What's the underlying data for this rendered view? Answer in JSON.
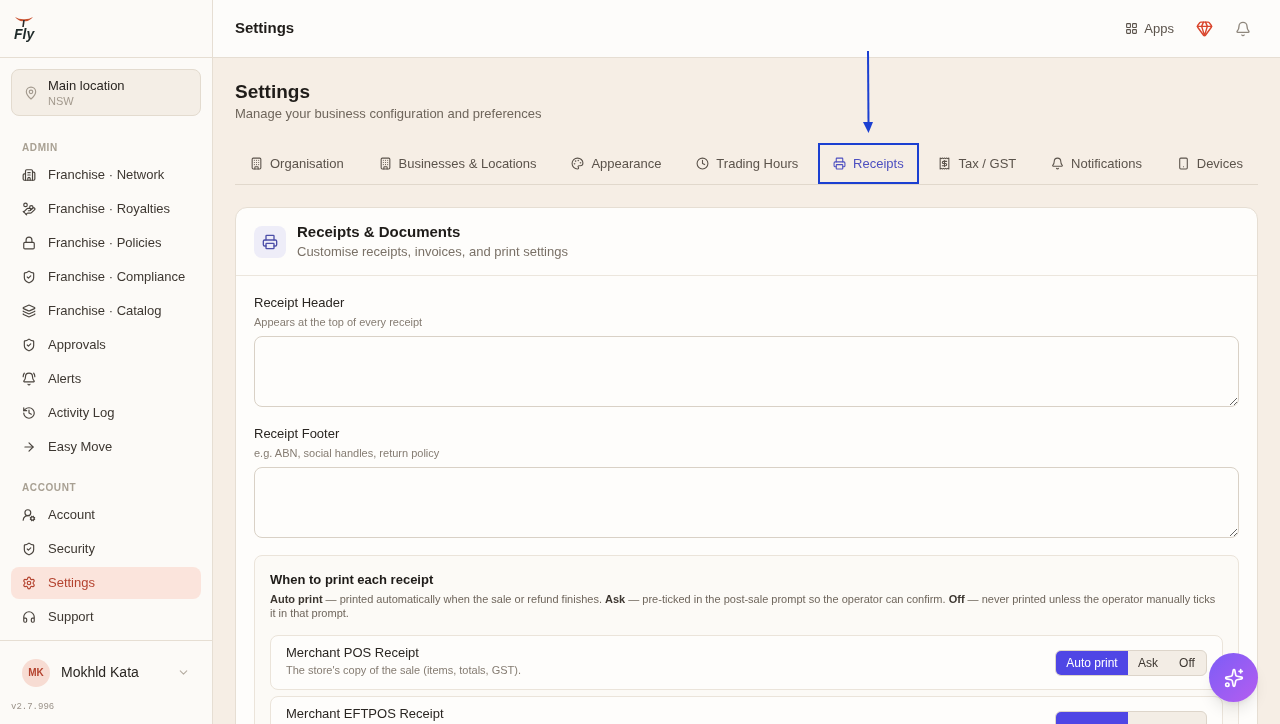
{
  "sidebar": {
    "logo": {
      "wordmark": "Fly"
    },
    "location": {
      "name": "Main location",
      "region": "NSW"
    },
    "sections": [
      {
        "title": "ADMIN",
        "items": [
          {
            "label": "Franchise · Network",
            "selected": false
          },
          {
            "label": "Franchise · Royalties",
            "selected": false
          },
          {
            "label": "Franchise · Policies",
            "selected": false
          },
          {
            "label": "Franchise · Compliance",
            "selected": false
          },
          {
            "label": "Franchise · Catalog",
            "selected": false
          },
          {
            "label": "Approvals",
            "selected": false
          },
          {
            "label": "Alerts",
            "selected": false
          },
          {
            "label": "Activity Log",
            "selected": false
          },
          {
            "label": "Easy Move",
            "selected": false
          }
        ]
      },
      {
        "title": "ACCOUNT",
        "items": [
          {
            "label": "Account",
            "selected": false
          },
          {
            "label": "Security",
            "selected": false
          },
          {
            "label": "Settings",
            "selected": true
          },
          {
            "label": "Support",
            "selected": false
          }
        ]
      }
    ],
    "user": {
      "initials": "MK",
      "name": "Mokhld Kata"
    },
    "version": "v2.7.996"
  },
  "topbar": {
    "title": "Settings",
    "apps_label": "Apps"
  },
  "page": {
    "title": "Settings",
    "subtitle": "Manage your business configuration and preferences"
  },
  "tabs": [
    {
      "label": "Organisation",
      "selected": false,
      "highlighted": false
    },
    {
      "label": "Businesses & Locations",
      "selected": false,
      "highlighted": false
    },
    {
      "label": "Appearance",
      "selected": false,
      "highlighted": false
    },
    {
      "label": "Trading Hours",
      "selected": false,
      "highlighted": false
    },
    {
      "label": "Receipts",
      "selected": true,
      "highlighted": true
    },
    {
      "label": "Tax / GST",
      "selected": false,
      "highlighted": false
    },
    {
      "label": "Notifications",
      "selected": false,
      "highlighted": false
    },
    {
      "label": "Devices",
      "selected": false,
      "highlighted": false
    }
  ],
  "card": {
    "title": "Receipts & Documents",
    "subtitle": "Customise receipts, invoices, and print settings",
    "fields": [
      {
        "label": "Receipt Header",
        "hint": "Appears at the top of every receipt"
      },
      {
        "label": "Receipt Footer",
        "hint": "e.g. ABN, social handles, return policy"
      }
    ],
    "print_rules": {
      "title": "When to print each receipt",
      "description": "**Auto print** — printed automatically when the sale or refund finishes. **Ask** — pre-ticked in the post-sale prompt so the operator can confirm. **Off** — never printed unless the operator manually ticks it in that prompt.",
      "receipts": [
        {
          "name": "Merchant POS Receipt",
          "description": "The store's copy of the sale (items, totals, GST).",
          "modes": [
            {
              "label": "Auto print",
              "selected": true
            },
            {
              "label": "Ask",
              "selected": false
            },
            {
              "label": "Off",
              "selected": false
            }
          ]
        },
        {
          "name": "Merchant EFTPOS Receipt",
          "modes": [
            {
              "selected": true
            },
            {
              "selected": false
            },
            {
              "selected": false
            }
          ]
        }
      ]
    }
  }
}
